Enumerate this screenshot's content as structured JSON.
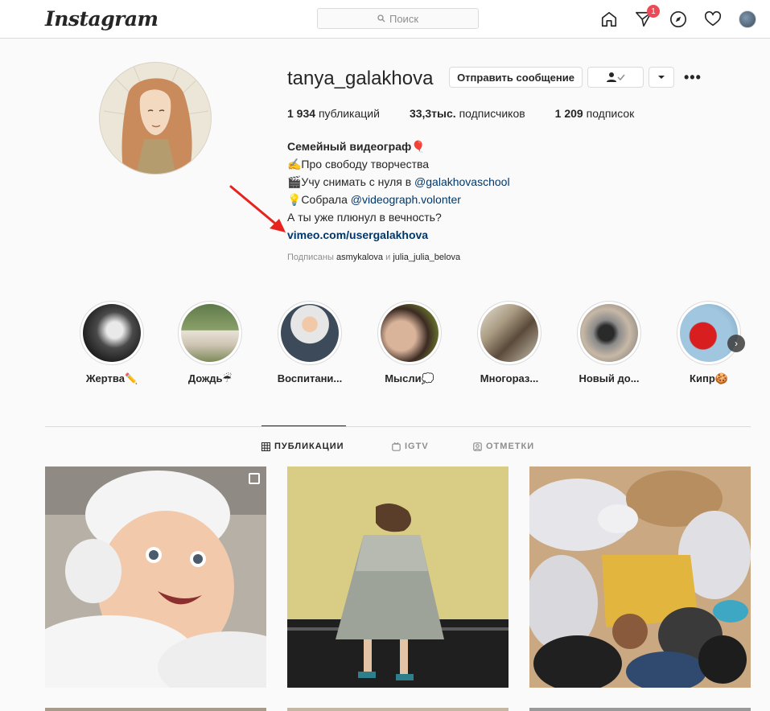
{
  "nav": {
    "logo": "Instagram",
    "search_placeholder": "Поиск",
    "notification_count": "1",
    "icons": [
      "home-icon",
      "direct-icon",
      "explore-icon",
      "activity-heart-icon",
      "profile-avatar"
    ]
  },
  "profile": {
    "username": "tanya_galakhova",
    "message_button": "Отправить сообщение",
    "stats": [
      {
        "value": "1 934",
        "label": "публикаций"
      },
      {
        "value": "33,3тыс.",
        "label": "подписчиков"
      },
      {
        "value": "1 209",
        "label": "подписок"
      }
    ],
    "bio": {
      "name": "Семейный видеограф🎈",
      "line1": "✍️Про свободу творчества",
      "line2_prefix": "🎬Учу снимать с нуля в ",
      "line2_link": "@galakhovaschool",
      "line3_prefix": "💡Собрала ",
      "line3_link": "@videograph.volonter",
      "line4": "А ты уже плюнул в вечность?",
      "website": "vimeo.com/usergalakhova"
    },
    "followed_by_prefix": "Подписаны",
    "followed_by_user1": "asmykalova",
    "followed_by_and": "и",
    "followed_by_user2": "julia_julia_belova"
  },
  "highlights": [
    {
      "label": "Жертва✏️"
    },
    {
      "label": "Дождь☔"
    },
    {
      "label": "Воспитани..."
    },
    {
      "label": "Мысли💭"
    },
    {
      "label": "Многораз..."
    },
    {
      "label": "Новый до..."
    },
    {
      "label": "Кипр🍪"
    }
  ],
  "tabs": [
    {
      "label": "ПУБЛИКАЦИИ",
      "active": true
    },
    {
      "label": "IGTV",
      "active": false
    },
    {
      "label": "ОТМЕТКИ",
      "active": false
    }
  ],
  "colors": {
    "accent_link": "#00376b",
    "badge": "#ed4956",
    "annotation_arrow": "#e8231f"
  }
}
